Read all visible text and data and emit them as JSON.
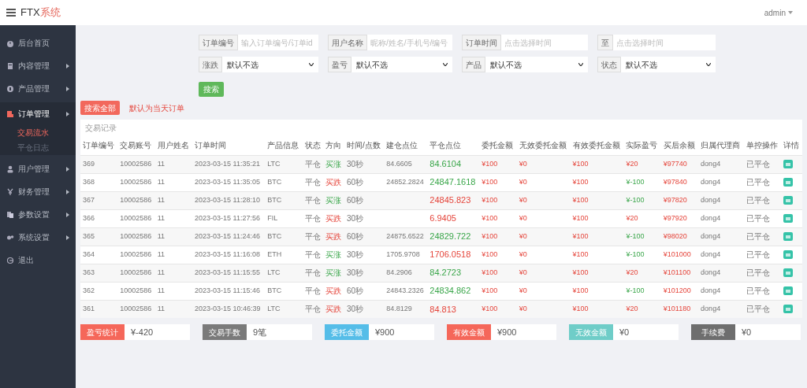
{
  "header": {
    "logo_prefix": "FTX",
    "logo_suffix": "系统",
    "user": "admin"
  },
  "sidebar": {
    "items": [
      {
        "label": "后台首页",
        "arrow": false,
        "expanded": false
      },
      {
        "label": "内容管理",
        "arrow": true,
        "expanded": false
      },
      {
        "label": "产品管理",
        "arrow": true,
        "expanded": false
      },
      {
        "label": "订单管理",
        "arrow": true,
        "expanded": true,
        "children": [
          {
            "label": "交易流水",
            "selected": true
          },
          {
            "label": "平仓日志",
            "selected": false
          }
        ]
      },
      {
        "label": "用户管理",
        "arrow": true,
        "expanded": false
      },
      {
        "label": "财务管理",
        "arrow": true,
        "expanded": false
      },
      {
        "label": "参数设置",
        "arrow": true,
        "expanded": false
      },
      {
        "label": "系统设置",
        "arrow": true,
        "expanded": false
      },
      {
        "label": "退出",
        "arrow": false,
        "expanded": false
      }
    ]
  },
  "filters": {
    "inputs": [
      {
        "label": "订单编号",
        "placeholder": "输入订单编号/订单id"
      },
      {
        "label": "用户名称",
        "placeholder": "昵称/姓名/手机号/编号"
      },
      {
        "label": "订单时间",
        "placeholder": "点击选择时间"
      },
      {
        "label": "至",
        "placeholder": "点击选择时间"
      }
    ],
    "selects": [
      {
        "label": "涨跌",
        "value": "默认不选"
      },
      {
        "label": "盈亏",
        "value": "默认不选"
      },
      {
        "label": "产品",
        "value": "默认不选"
      },
      {
        "label": "状态",
        "value": "默认不选"
      }
    ],
    "search_button": "搜索"
  },
  "actions": {
    "search_all": "搜索全部",
    "note": "默认为当天订单"
  },
  "table": {
    "title": "交易记录",
    "columns": [
      "订单编号",
      "交易账号",
      "用户姓名",
      "订单时间",
      "产品信息",
      "状态",
      "方向",
      "时间/点数",
      "建仓点位",
      "平仓点位",
      "委托金额",
      "无效委托金额",
      "有效委托金额",
      "实际盈亏",
      "买后余额",
      "归属代理商",
      "单控操作",
      "详情"
    ],
    "rows": [
      {
        "id": "369",
        "account": "10002586",
        "name": "11",
        "time": "2023-03-15 11:35:21",
        "product": "LTC",
        "status": "平仓",
        "direction": {
          "text": "买涨",
          "kind": "rise"
        },
        "duration": "30秒",
        "open": "84.6605",
        "close": {
          "text": "84.6104",
          "kind": "down"
        },
        "amount": "¥100",
        "invalid": "¥0",
        "valid": "¥100",
        "profit": {
          "text": "¥20",
          "kind": "gain"
        },
        "balance": "¥97740",
        "agent": "dong4",
        "op": "已平仓"
      },
      {
        "id": "368",
        "account": "10002586",
        "name": "11",
        "time": "2023-03-15 11:35:05",
        "product": "BTC",
        "status": "平仓",
        "direction": {
          "text": "买跌",
          "kind": "fall"
        },
        "duration": "60秒",
        "open": "24852.2824",
        "close": {
          "text": "24847.1618",
          "kind": "down"
        },
        "amount": "¥100",
        "invalid": "¥0",
        "valid": "¥100",
        "profit": {
          "text": "¥-100",
          "kind": "loss"
        },
        "balance": "¥97840",
        "agent": "dong4",
        "op": "已平仓"
      },
      {
        "id": "367",
        "account": "10002586",
        "name": "11",
        "time": "2023-03-15 11:28:10",
        "product": "BTC",
        "status": "平仓",
        "direction": {
          "text": "买涨",
          "kind": "rise"
        },
        "duration": "60秒",
        "close": {
          "text": "24845.823",
          "kind": "up"
        },
        "amount": "¥100",
        "invalid": "¥0",
        "valid": "¥100",
        "profit": {
          "text": "¥-100",
          "kind": "loss"
        },
        "balance": "¥97820",
        "agent": "dong4",
        "op": "已平仓"
      },
      {
        "id": "366",
        "account": "10002586",
        "name": "11",
        "time": "2023-03-15 11:27:56",
        "product": "FIL",
        "status": "平仓",
        "direction": {
          "text": "买跌",
          "kind": "fall"
        },
        "duration": "30秒",
        "close": {
          "text": "6.9405",
          "kind": "up"
        },
        "amount": "¥100",
        "invalid": "¥0",
        "valid": "¥100",
        "profit": {
          "text": "¥20",
          "kind": "gain"
        },
        "balance": "¥97920",
        "agent": "dong4",
        "op": "已平仓"
      },
      {
        "id": "365",
        "account": "10002586",
        "name": "11",
        "time": "2023-03-15 11:24:46",
        "product": "BTC",
        "status": "平仓",
        "direction": {
          "text": "买跌",
          "kind": "fall"
        },
        "duration": "60秒",
        "open": "24875.6522",
        "close": {
          "text": "24829.722",
          "kind": "down"
        },
        "amount": "¥100",
        "invalid": "¥0",
        "valid": "¥100",
        "profit": {
          "text": "¥-100",
          "kind": "loss"
        },
        "balance": "¥98020",
        "agent": "dong4",
        "op": "已平仓"
      },
      {
        "id": "364",
        "account": "10002586",
        "name": "11",
        "time": "2023-03-15 11:16:08",
        "product": "ETH",
        "status": "平仓",
        "direction": {
          "text": "买涨",
          "kind": "rise"
        },
        "duration": "30秒",
        "open": "1705.9708",
        "close": {
          "text": "1706.0518",
          "kind": "up"
        },
        "amount": "¥100",
        "invalid": "¥0",
        "valid": "¥100",
        "profit": {
          "text": "¥-100",
          "kind": "loss"
        },
        "balance": "¥101000",
        "agent": "dong4",
        "op": "已平仓"
      },
      {
        "id": "363",
        "account": "10002586",
        "name": "11",
        "time": "2023-03-15 11:15:55",
        "product": "LTC",
        "status": "平仓",
        "direction": {
          "text": "买涨",
          "kind": "rise"
        },
        "duration": "30秒",
        "open": "84.2906",
        "close": {
          "text": "84.2723",
          "kind": "down"
        },
        "amount": "¥100",
        "invalid": "¥0",
        "valid": "¥100",
        "profit": {
          "text": "¥20",
          "kind": "gain"
        },
        "balance": "¥101100",
        "agent": "dong4",
        "op": "已平仓"
      },
      {
        "id": "362",
        "account": "10002586",
        "name": "11",
        "time": "2023-03-15 11:15:46",
        "product": "BTC",
        "status": "平仓",
        "direction": {
          "text": "买跌",
          "kind": "fall"
        },
        "duration": "60秒",
        "open": "24843.2326",
        "close": {
          "text": "24834.862",
          "kind": "down"
        },
        "amount": "¥100",
        "invalid": "¥0",
        "valid": "¥100",
        "profit": {
          "text": "¥-100",
          "kind": "loss"
        },
        "balance": "¥101200",
        "agent": "dong4",
        "op": "已平仓"
      },
      {
        "id": "361",
        "account": "10002586",
        "name": "11",
        "time": "2023-03-15 10:46:39",
        "product": "LTC",
        "status": "平仓",
        "direction": {
          "text": "买跌",
          "kind": "fall"
        },
        "duration": "30秒",
        "open": "84.8129",
        "close": {
          "text": "84.813",
          "kind": "up"
        },
        "amount": "¥100",
        "invalid": "¥0",
        "valid": "¥100",
        "profit": {
          "text": "¥20",
          "kind": "gain"
        },
        "balance": "¥101180",
        "agent": "dong4",
        "op": "已平仓"
      }
    ]
  },
  "summary": [
    {
      "label": "盈亏统计",
      "value": "¥-420",
      "color": "#f5675a"
    },
    {
      "label": "交易手数",
      "value": "9笔",
      "color": "#7a7a7a"
    },
    {
      "label": "委托金额",
      "value": "¥900",
      "color": "#55bde8"
    },
    {
      "label": "有效金额",
      "value": "¥900",
      "color": "#f5675a"
    },
    {
      "label": "无效金额",
      "value": "¥0",
      "color": "#6fcdc8"
    },
    {
      "label": "手续费",
      "value": "¥0",
      "color": "#6e6e6e"
    }
  ]
}
